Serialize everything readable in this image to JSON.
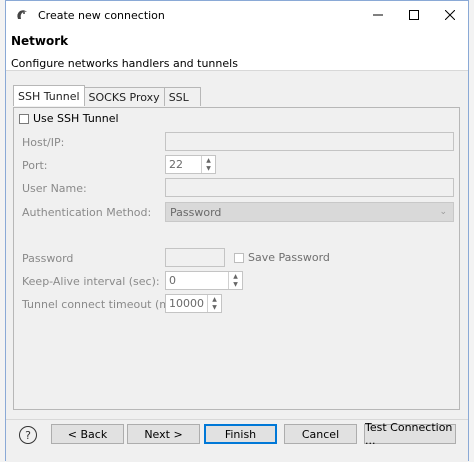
{
  "window": {
    "title": "Create new connection"
  },
  "header": {
    "title": "Network",
    "description": "Configure networks handlers and tunnels"
  },
  "tabs": [
    {
      "label": "SSH Tunnel",
      "active": true
    },
    {
      "label": "SOCKS Proxy",
      "active": false
    },
    {
      "label": "SSL",
      "active": false
    }
  ],
  "ssh": {
    "use_ssh_tunnel_label": "Use SSH Tunnel",
    "host_label": "Host/IP:",
    "host_value": "",
    "port_label": "Port:",
    "port_value": "22",
    "username_label": "User Name:",
    "username_value": "",
    "auth_method_label": "Authentication Method:",
    "auth_method_value": "Password",
    "password_label": "Password",
    "password_value": "",
    "save_password_label": "Save Password",
    "keepalive_label": "Keep-Alive interval (sec):",
    "keepalive_value": "0",
    "timeout_label": "Tunnel connect timeout (ms):",
    "timeout_value": "10000"
  },
  "footer": {
    "help_label": "?",
    "back_label": "< Back",
    "next_label": "Next >",
    "finish_label": "Finish",
    "cancel_label": "Cancel",
    "test_connection_label": "Test Connection ..."
  },
  "colors": {
    "accent": "#0078d7",
    "window_border": "#8aa9d6",
    "disabled_text": "#8a8a8a"
  }
}
